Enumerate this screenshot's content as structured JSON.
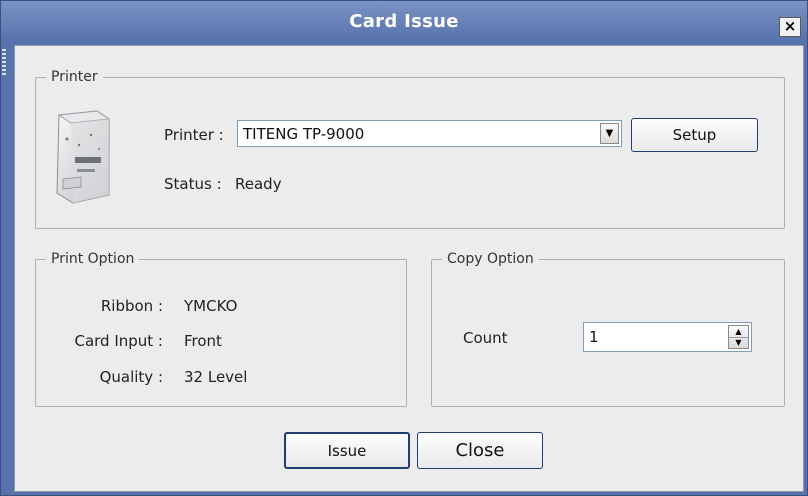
{
  "window": {
    "title": "Card Issue",
    "close_glyph": "×"
  },
  "printer_group": {
    "legend": "Printer",
    "printer_label": "Printer :",
    "printer_value": "TITENG TP-9000",
    "dropdown_glyph": "▼",
    "setup_label": "Setup",
    "status_label": "Status :",
    "status_value": "Ready",
    "image_icon": "card-printer-icon"
  },
  "print_option": {
    "legend": "Print Option",
    "ribbon_label": "Ribbon :",
    "ribbon_value": "YMCKO",
    "card_input_label": "Card Input :",
    "card_input_value": "Front",
    "quality_label": "Quality :",
    "quality_value": "32 Level"
  },
  "copy_option": {
    "legend": "Copy Option",
    "count_label": "Count",
    "count_value": "1",
    "spin_up_glyph": "▲",
    "spin_down_glyph": "▼"
  },
  "buttons": {
    "issue_label": "Issue",
    "close_label": "Close"
  },
  "colors": {
    "titlebar": "#5872ad",
    "dialog_bg": "#ececec",
    "button_border": "#1f3d6f"
  }
}
